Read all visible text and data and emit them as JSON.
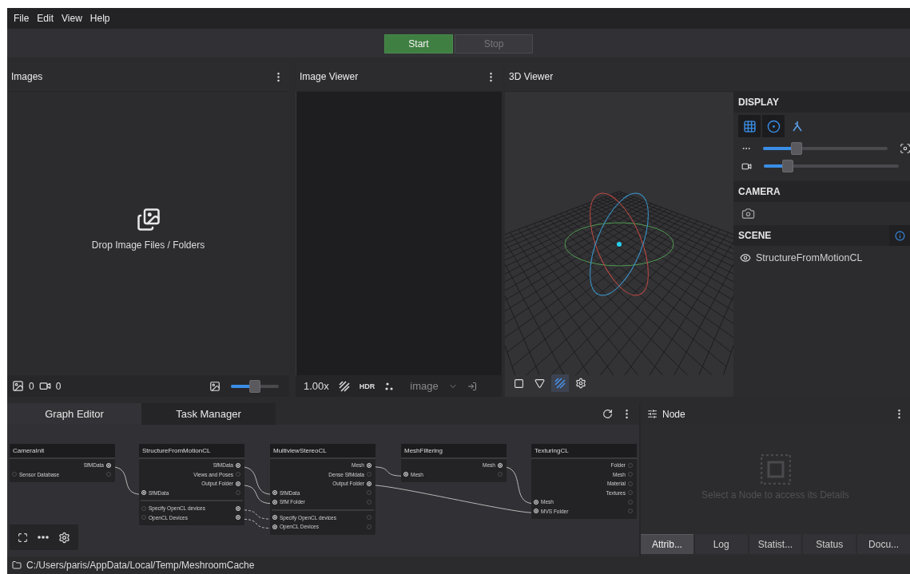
{
  "menu": [
    "File",
    "Edit",
    "View",
    "Help"
  ],
  "run_controls": [
    {
      "label": "Start",
      "kind": "start",
      "disabled": false
    },
    {
      "label": "Stop",
      "kind": "stop",
      "disabled": true
    }
  ],
  "images_panel": {
    "title": "Images",
    "drop_hint": "Drop Image Files / Folders",
    "image_count": "0",
    "video_count": "0",
    "thumbnail_size": {
      "level": 0.5
    }
  },
  "image_viewer": {
    "title": "Image Viewer",
    "zoom": "1.00x",
    "hdr_label": "HDR",
    "channel": "image"
  },
  "viewer_3d": {
    "title": "3D Viewer",
    "display": {
      "heading": "DISPLAY",
      "modes": [
        {
          "on": true
        },
        {
          "on": true
        },
        {
          "on": false
        }
      ],
      "point_size": {
        "level": 0.27
      },
      "camera_scale": {
        "level": 0.18
      }
    },
    "camera": {
      "heading": "CAMERA"
    },
    "scene": {
      "heading": "SCENE",
      "items": [
        {
          "name": "StructureFromMotionCL",
          "visible": true
        }
      ]
    },
    "tools": [
      {
        "on": false
      },
      {
        "on": false
      },
      {
        "on": true
      },
      {
        "on": false
      }
    ]
  },
  "graph": {
    "tabs": [
      {
        "label": "Graph Editor",
        "selected": true
      },
      {
        "label": "Task Manager",
        "selected": false
      }
    ],
    "nodes": [
      {
        "title": "CameraInit",
        "outputs": [
          {
            "label": "SfMData",
            "connected": true
          }
        ],
        "inputs": [
          {
            "label": "Sensor Database",
            "connected": false,
            "output_connected": false
          }
        ]
      },
      {
        "title": "StructureFromMotionCL",
        "outputs": [
          {
            "label": "SfMData",
            "connected": true
          },
          {
            "label": "Views and Poses",
            "connected": false
          },
          {
            "label": "Output Folder",
            "connected": true
          }
        ],
        "inputs": [
          {
            "label": "SfMData",
            "connected": true,
            "output_connected": false
          }
        ],
        "advanced": [
          {
            "label": "Specify OpenCL devices",
            "connected": false,
            "output_connected": true
          },
          {
            "label": "OpenCL Devices",
            "connected": false,
            "output_connected": true
          }
        ]
      },
      {
        "title": "MultiviewStereoCL",
        "outputs": [
          {
            "label": "Mesh",
            "connected": true
          },
          {
            "label": "Dense SfMdata",
            "connected": false
          },
          {
            "label": "Output Folder",
            "connected": true
          }
        ],
        "inputs": [
          {
            "label": "SfMData",
            "connected": true,
            "output_connected": false
          },
          {
            "label": "SfM Folder",
            "connected": true,
            "output_connected": false
          }
        ],
        "advanced": [
          {
            "label": "Specify OpenCL devices",
            "connected": true,
            "output_connected": false
          },
          {
            "label": "OpenCL Devices",
            "connected": true,
            "output_connected": false
          }
        ]
      },
      {
        "title": "MeshFiltering",
        "outputs": [
          {
            "label": "Mesh",
            "connected": true
          }
        ],
        "inputs": [
          {
            "label": "Mesh",
            "connected": true,
            "output_connected": false
          }
        ]
      },
      {
        "title": "TexturingCL",
        "outputs": [
          {
            "label": "Folder",
            "connected": false
          },
          {
            "label": "Mesh",
            "connected": false
          },
          {
            "label": "Material",
            "connected": false
          },
          {
            "label": "Textures",
            "connected": false
          }
        ],
        "inputs": [
          {
            "label": "Mesh",
            "connected": true,
            "output_connected": false
          },
          {
            "label": "MVS Folder",
            "connected": true,
            "output_connected": false
          }
        ]
      }
    ]
  },
  "node_panel": {
    "title": "Node",
    "hint": "Select a Node to access its Details",
    "tabs": [
      {
        "label": "Attrib...",
        "selected": true
      },
      {
        "label": "Log",
        "selected": false
      },
      {
        "label": "Statist...",
        "selected": false
      },
      {
        "label": "Status",
        "selected": false
      },
      {
        "label": "Docu...",
        "selected": false
      }
    ]
  },
  "status_bar": {
    "path": "C:/Users/paris/AppData/Local/Temp/MeshroomCache"
  }
}
